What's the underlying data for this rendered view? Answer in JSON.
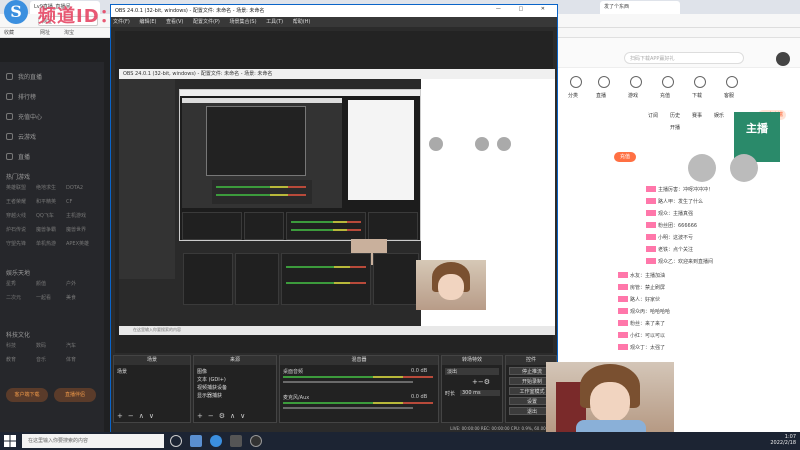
{
  "watermark": "频道ID：0v8302  直播：带风lv9",
  "browser": {
    "tab1": "Lv9直播_直播间",
    "tab2": "发了个东西",
    "url": "网址",
    "bookmarks": [
      "收藏",
      "网址",
      "淘宝"
    ],
    "logo": "S"
  },
  "sidebar": {
    "items": [
      "我的直播",
      "排行榜",
      "充值中心",
      "云游戏",
      "直播"
    ],
    "section1": "热门游戏",
    "sub1": [
      "英雄联盟",
      "绝地求生",
      "DOTA2",
      "王者荣耀",
      "和平精英",
      "CF",
      "穿越火线",
      "QQ飞车",
      "主机游戏",
      "炉石传说",
      "魔兽争霸",
      "魔兽世界",
      "守望先锋",
      "单机热游",
      "APEX英雄"
    ],
    "section2": "娱乐天地",
    "sub2": [
      "星秀",
      "颜值",
      "户外",
      "二次元",
      "一起看",
      "美食"
    ],
    "section3": "科技文化",
    "sub3": [
      "科技",
      "数码",
      "汽车",
      "教育",
      "音乐",
      "体育"
    ],
    "btn1": "客户端下载",
    "btn2": "直播伴侣"
  },
  "right_page": {
    "search_placeholder": "扫码下载APP赢好礼",
    "top_icons": [
      "分类",
      "直播",
      "游戏",
      "充值",
      "下载",
      "客服"
    ],
    "row_labels": [
      "订阅",
      "历史",
      "赛事",
      "娱乐",
      "开播"
    ],
    "badge": "PC客户端",
    "bal_label": "充值",
    "banner": "主播",
    "chat": [
      "主播厉害：冲呀冲冲冲！",
      "路人甲：发生了什么",
      "观众：主播真强",
      "粉丝团：666666",
      "小明：这波不亏",
      "老铁：点个关注",
      "观众乙：欢迎来到直播间",
      "水友：主播加油",
      "房管：禁止刷屏",
      "路人：好家伙",
      "观众丙：哈哈哈哈",
      "粉丝：来了来了",
      "小红：可以可以",
      "观众丁：太强了"
    ]
  },
  "obs": {
    "title": "OBS 24.0.1 (32-bit, windows) - 配置文件: 未命名 - 场景: 未命名",
    "window_controls": "— □ ✕",
    "menu": [
      "文件(F)",
      "编辑(E)",
      "查看(V)",
      "配置文件(P)",
      "场景集合(S)",
      "工具(T)",
      "帮助(H)"
    ],
    "nested_title": "OBS 24.0.1 (32-bit, windows) - 配置文件: 未命名 - 场景: 未命名",
    "nested_taskbar": "在这里输入你要搜索的内容",
    "docks": {
      "scenes_title": "场景",
      "scenes": [
        "场景"
      ],
      "sources_title": "来源",
      "sources": [
        "图像",
        "文本 (GDI+)",
        "视频捕获设备",
        "显示器捕获"
      ],
      "mixer_title": "混音器",
      "mixer": [
        {
          "name": "桌面音频",
          "db": "0.0 dB"
        },
        {
          "name": "麦克风/Aux",
          "db": "0.0 dB"
        }
      ],
      "transitions_title": "转场特效",
      "transition_type": "淡出",
      "duration_label": "时长",
      "duration_value": "300 ms",
      "controls_title": "控件",
      "controls": [
        "停止推流",
        "开始录制",
        "工作室模式",
        "设置",
        "退出"
      ]
    },
    "status": "LIVE: 00:00:00   REC: 00:00:00   CPU: 0.9%, 60.00 fps"
  },
  "taskbar": {
    "search": "在这里输入你要搜索的内容",
    "time": "1:07",
    "date": "2022/2/18"
  }
}
